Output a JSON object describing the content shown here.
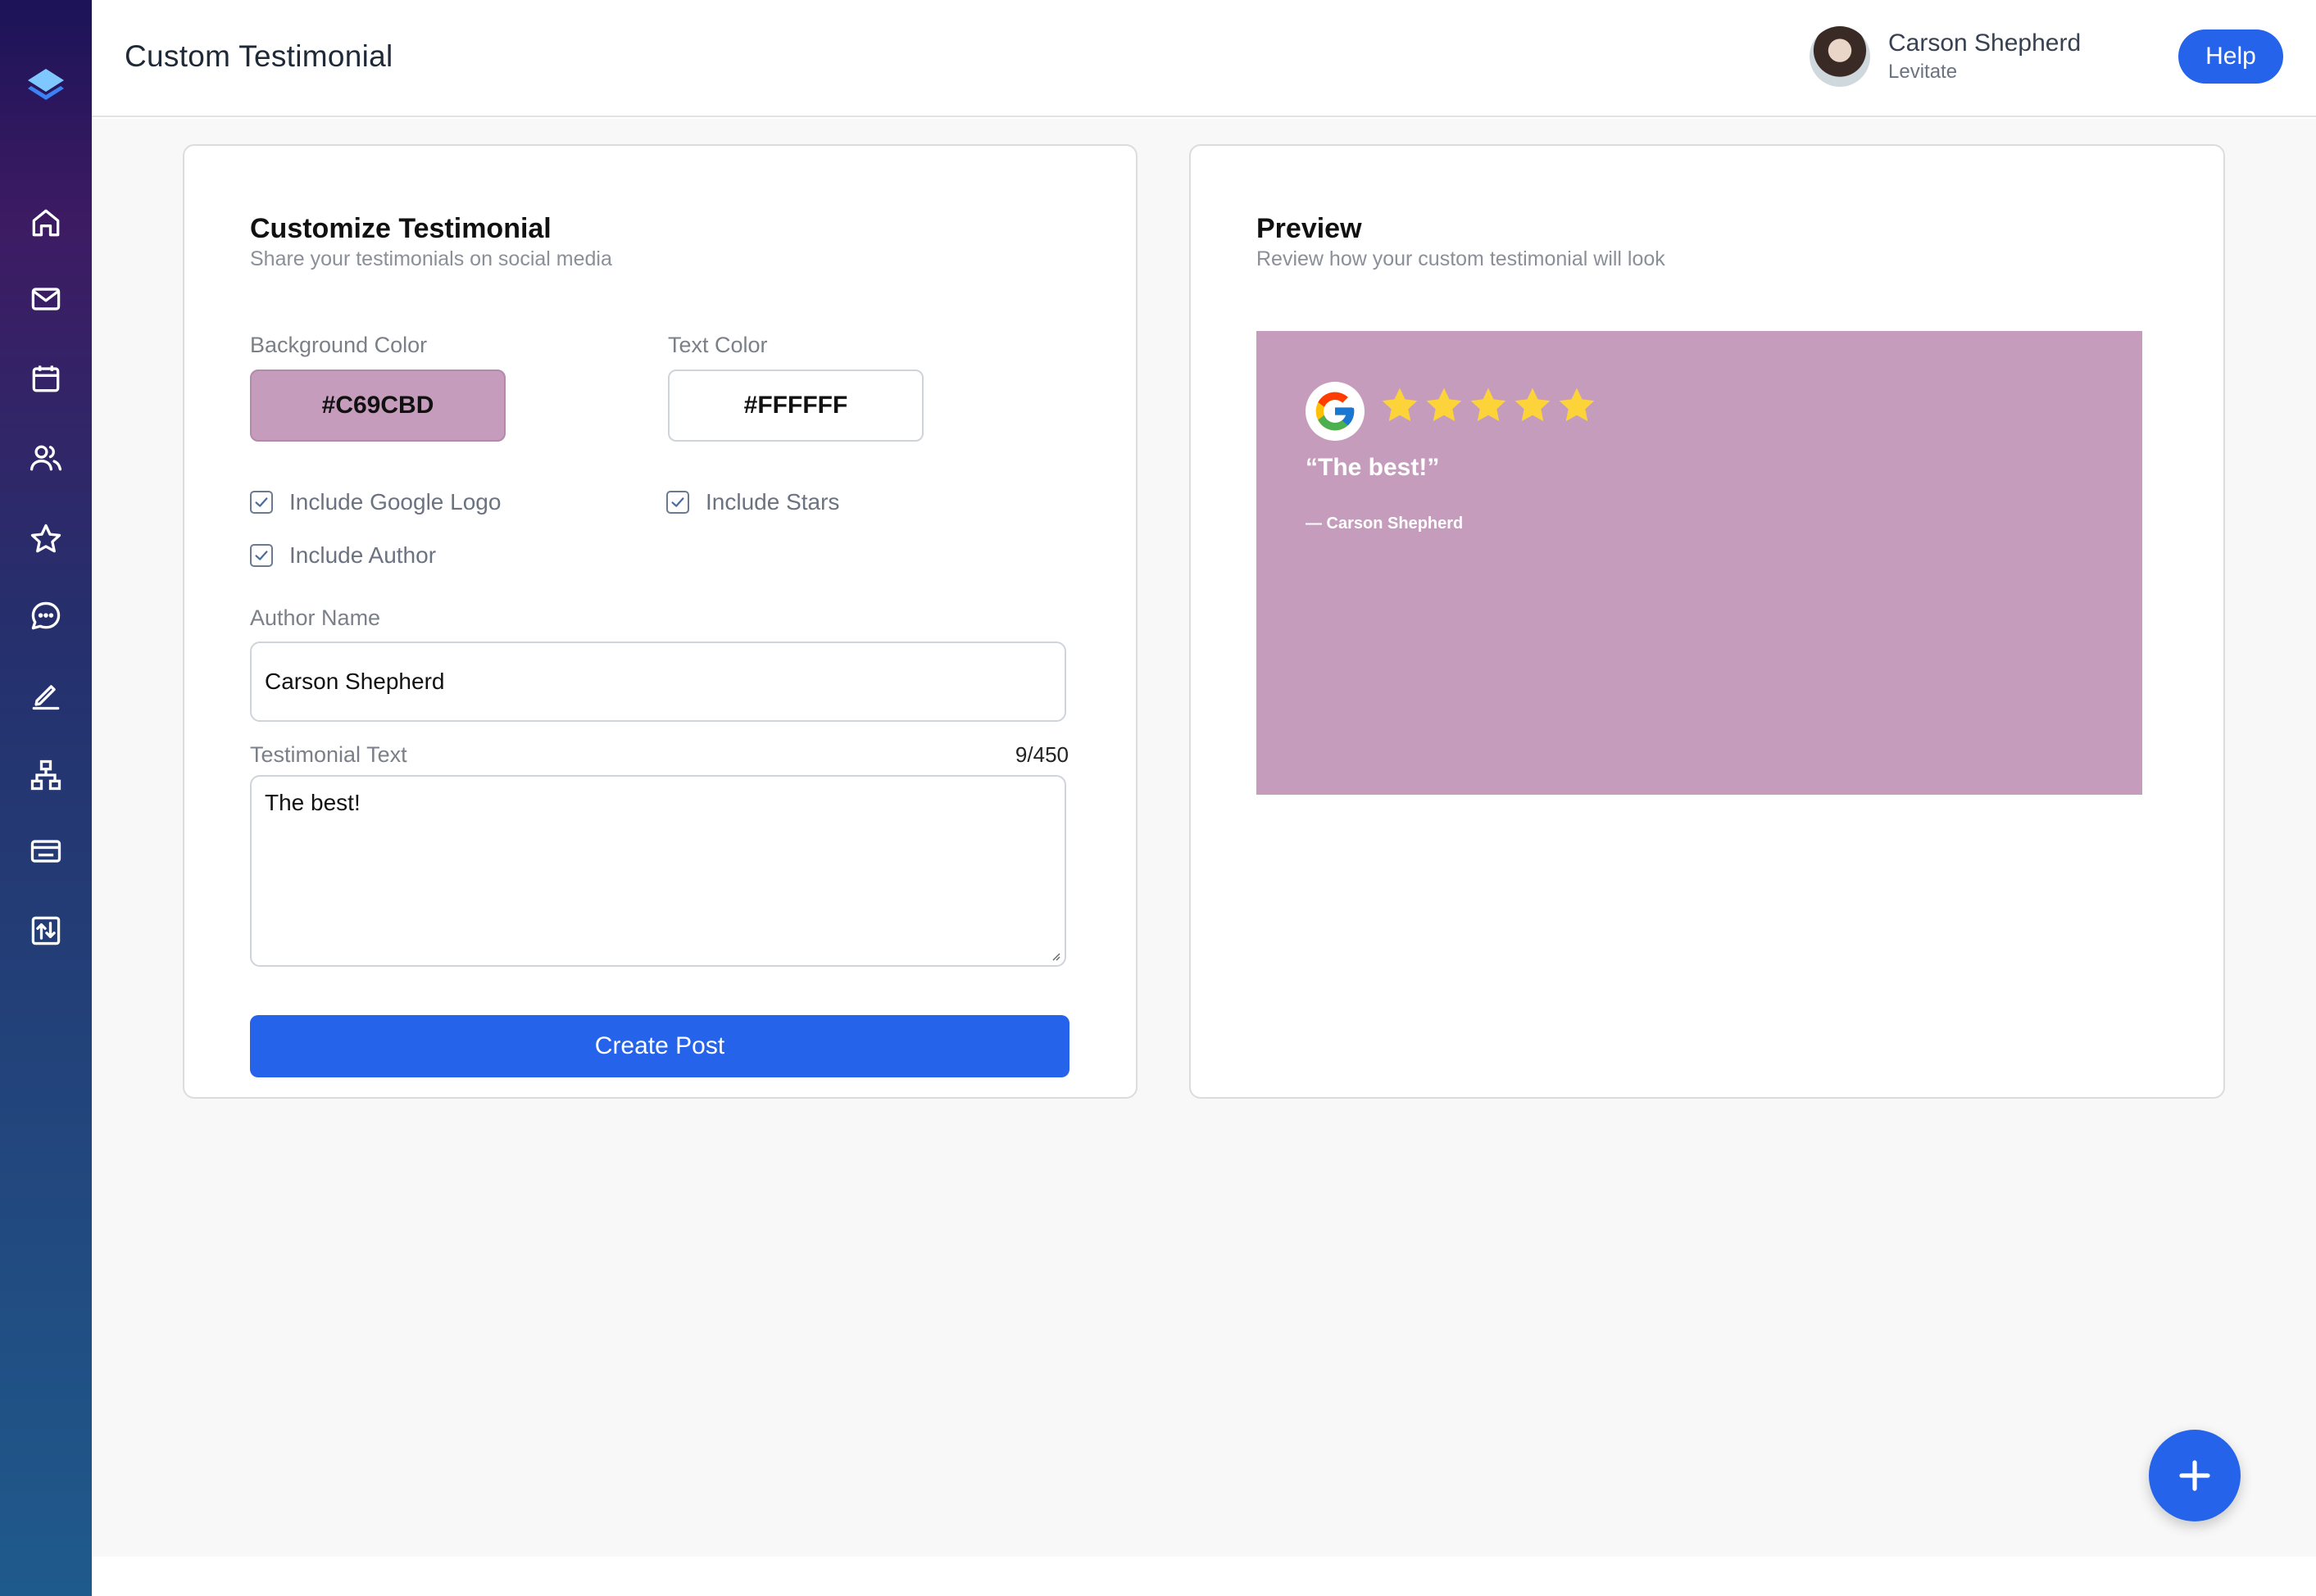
{
  "header": {
    "title": "Custom Testimonial",
    "user_name": "Carson Shepherd",
    "user_org": "Levitate",
    "help_label": "Help"
  },
  "sidebar": {
    "items": [
      {
        "icon": "home-icon"
      },
      {
        "icon": "mail-icon"
      },
      {
        "icon": "calendar-icon"
      },
      {
        "icon": "users-icon"
      },
      {
        "icon": "star-icon"
      },
      {
        "icon": "chat-icon"
      },
      {
        "icon": "edit-icon"
      },
      {
        "icon": "org-chart-icon"
      },
      {
        "icon": "credit-card-icon"
      },
      {
        "icon": "import-export-icon"
      }
    ]
  },
  "form": {
    "title": "Customize Testimonial",
    "subtitle": "Share your testimonials on social media",
    "background_color_label": "Background Color",
    "background_color_value": "#C69CBD",
    "text_color_label": "Text Color",
    "text_color_value": "#FFFFFF",
    "checkboxes": [
      {
        "label": "Include Google Logo",
        "checked": true
      },
      {
        "label": "Include Stars",
        "checked": true
      },
      {
        "label": "Include Author",
        "checked": true
      }
    ],
    "author_label": "Author Name",
    "author_value": "Carson Shepherd",
    "testimonial_label": "Testimonial Text",
    "testimonial_counter": "9/450",
    "testimonial_value": "The best!",
    "create_label": "Create Post"
  },
  "preview": {
    "title": "Preview",
    "subtitle": "Review how your custom testimonial will look",
    "quote": "“The best!”",
    "author": "— Carson Shepherd",
    "star_count": 5,
    "star_color": "#FDD33A"
  },
  "colors": {
    "accent": "#2563EB",
    "preview_bg": "#C69CBD",
    "preview_text": "#FFFFFF"
  }
}
